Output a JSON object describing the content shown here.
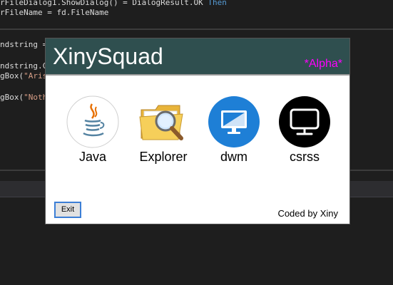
{
  "editor": {
    "top_lines": [
      "rFileDialog1.ShowDialog() = DialogResult.OK Then",
      "rFileName = fd.FileName"
    ],
    "mid_lines": [
      "ndstring = ",
      "",
      "ndstring.Co",
      "gBox(\"Aris",
      "",
      "gBox(\"Noth"
    ]
  },
  "dialog": {
    "title": "XinySquad",
    "badge": "*Alpha*",
    "apps": [
      {
        "label": "Java",
        "icon": "java-icon"
      },
      {
        "label": "Explorer",
        "icon": "explorer-folder-icon"
      },
      {
        "label": "dwm",
        "icon": "dwm-monitor-icon"
      },
      {
        "label": "csrss",
        "icon": "csrss-monitor-icon"
      }
    ],
    "exit_label": "Exit",
    "credit": "Coded by Xiny"
  },
  "colors": {
    "header": "#2f4f4f",
    "badge": "#ff00ff",
    "dwm_blue": "#1e7fd6",
    "csrss_black": "#000000"
  }
}
